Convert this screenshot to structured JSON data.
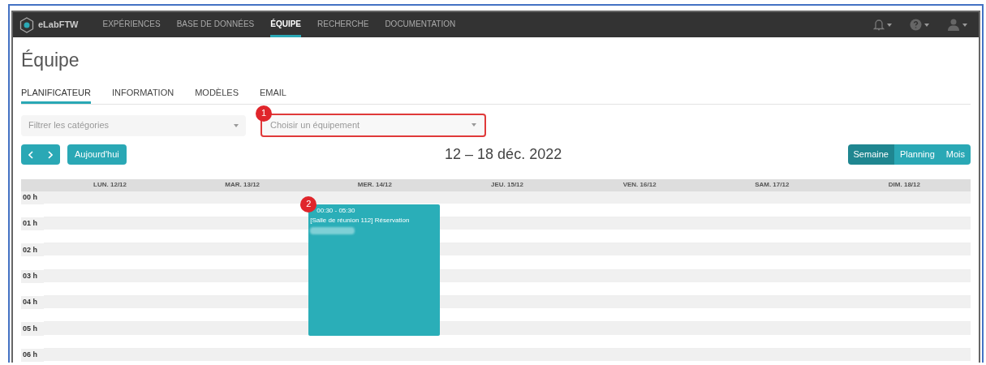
{
  "navbar": {
    "brand": "eLabFTW",
    "items": [
      {
        "label": "EXPÉRIENCES",
        "selected": false
      },
      {
        "label": "BASE DE DONNÉES",
        "selected": false
      },
      {
        "label": "ÉQUIPE",
        "selected": true
      },
      {
        "label": "RECHERCHE",
        "selected": false
      },
      {
        "label": "DOCUMENTATION",
        "selected": false
      }
    ]
  },
  "page_title": "Équipe",
  "tabs": [
    {
      "label": "PLANIFICATEUR",
      "selected": true
    },
    {
      "label": "INFORMATION",
      "selected": false
    },
    {
      "label": "MODÈLES",
      "selected": false
    },
    {
      "label": "EMAIL",
      "selected": false
    }
  ],
  "category_filter": {
    "placeholder": "Filtrer les catégories"
  },
  "equipment_select": {
    "placeholder": "Choisir un équipement",
    "annotation": "1"
  },
  "today_button": "Aujourd'hui",
  "date_range": "12 – 18 déc. 2022",
  "views": [
    {
      "label": "Semaine",
      "selected": true
    },
    {
      "label": "Planning",
      "selected": false
    },
    {
      "label": "Mois",
      "selected": false
    }
  ],
  "calendar": {
    "days": [
      {
        "label": "LUN. 12/12"
      },
      {
        "label": "MAR. 13/12"
      },
      {
        "label": "MER. 14/12",
        "events": [
          {
            "time": "00:30 - 05:30",
            "title": "[Salle de réunion 112] Réservation",
            "annotation": "2"
          }
        ]
      },
      {
        "label": "JEU. 15/12"
      },
      {
        "label": "VEN. 16/12"
      },
      {
        "label": "SAM. 17/12"
      },
      {
        "label": "DIM. 18/12"
      }
    ],
    "hours": [
      "00 h",
      "01 h",
      "02 h",
      "03 h",
      "04 h",
      "05 h",
      "06 h"
    ]
  }
}
